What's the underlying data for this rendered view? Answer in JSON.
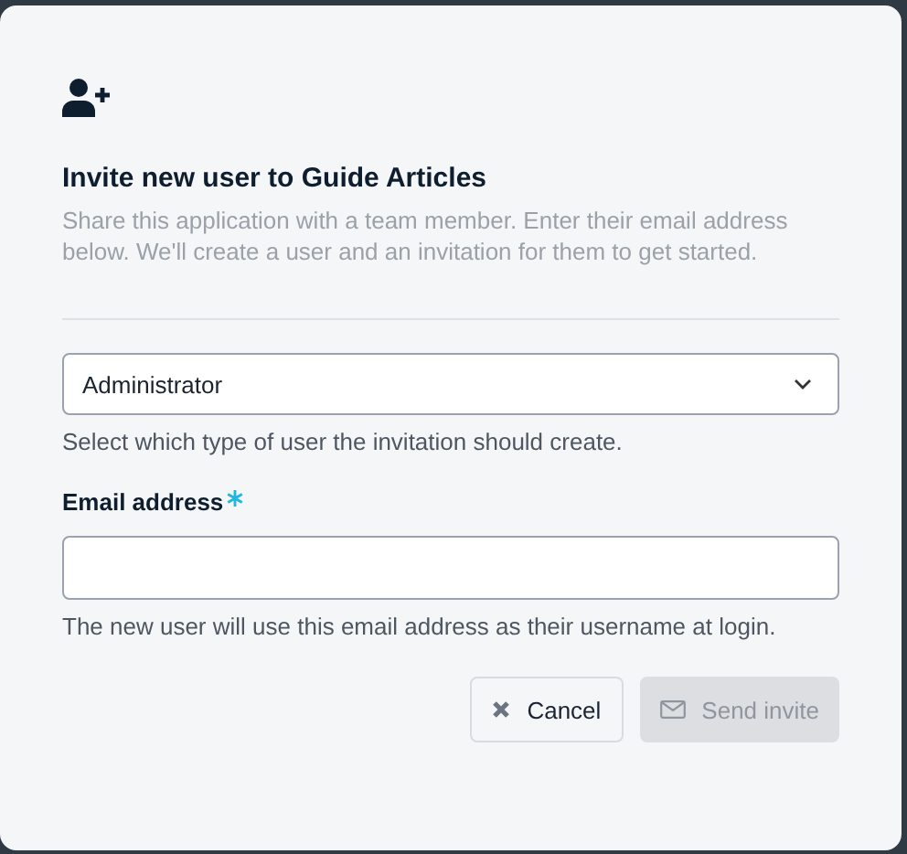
{
  "dialog": {
    "title": "Invite new user to Guide Articles",
    "description": "Share this application with a team member. Enter their email address below. We'll create a user and an invitation for them to get started.",
    "role_select": {
      "value": "Administrator",
      "help": "Select which type of user the invitation should create."
    },
    "email_field": {
      "label": "Email address",
      "required": true,
      "help": "The new user will use this email address as their username at login."
    },
    "buttons": [
      {
        "kind": "cancel",
        "label": "Cancel",
        "disabled": false
      },
      {
        "kind": "send",
        "label": "Send invite",
        "disabled": true
      }
    ]
  }
}
